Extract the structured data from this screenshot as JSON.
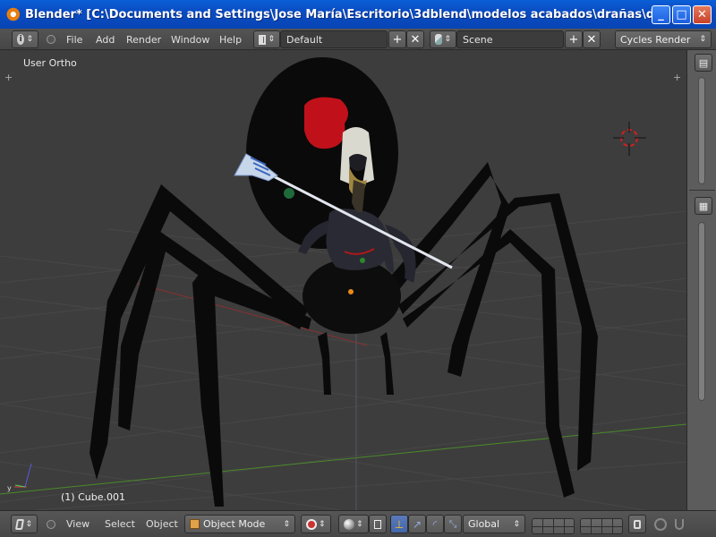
{
  "window": {
    "title": "Blender* [C:\\Documents and Settings\\Jose María\\Escritorio\\3dblend\\modelos acabados\\drañas\\draña low poly\\...",
    "minimize_glyph": "_",
    "maximize_glyph": "□",
    "close_glyph": "✕"
  },
  "top_header": {
    "menus": [
      "File",
      "Add",
      "Render",
      "Window",
      "Help"
    ],
    "screen_layout": "Default",
    "scene": "Scene",
    "render_engine": "Cycles Render",
    "plus_glyph": "+",
    "x_glyph": "✕",
    "arrows_glyph": "⇕"
  },
  "viewport": {
    "view_label": "User Ortho",
    "object_label": "(1) Cube.001",
    "corner_plus": "+"
  },
  "bottom_header": {
    "menus": [
      "View",
      "Select",
      "Object"
    ],
    "mode": "Object Mode",
    "orientation": "Global",
    "arrows_glyph": "⇕"
  },
  "colors": {
    "title_bar": "#0a4cc2",
    "header_bg": "#4d4d4d",
    "viewport_bg": "#3d3d3d",
    "grid_red_axis": "#8a3030",
    "grid_green_axis": "#4a8a2a",
    "spider_body": "#0a0a0a",
    "spider_marking": "#c0111a"
  }
}
